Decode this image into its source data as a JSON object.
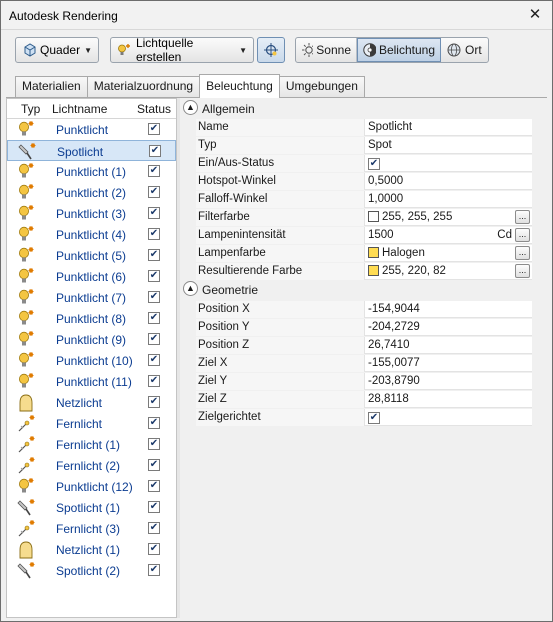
{
  "window": {
    "title": "Autodesk Rendering"
  },
  "toolbar": {
    "quader": "Quader",
    "create_light": "Lichtquelle erstellen",
    "sonne": "Sonne",
    "belichtung": "Belichtung",
    "ort": "Ort"
  },
  "tabs": [
    "Materialien",
    "Materialzuordnung",
    "Beleuchtung",
    "Umgebungen"
  ],
  "light_list": {
    "headers": {
      "type": "Typ",
      "name": "Lichtname",
      "status": "Status"
    },
    "items": [
      {
        "name": "Punktlicht",
        "icon": "point-light-icon"
      },
      {
        "name": "Spotlicht",
        "icon": "spot-light-icon"
      },
      {
        "name": "Punktlicht (1)",
        "icon": "point-light-icon"
      },
      {
        "name": "Punktlicht (2)",
        "icon": "point-light-icon"
      },
      {
        "name": "Punktlicht (3)",
        "icon": "point-light-icon"
      },
      {
        "name": "Punktlicht (4)",
        "icon": "point-light-icon"
      },
      {
        "name": "Punktlicht (5)",
        "icon": "point-light-icon"
      },
      {
        "name": "Punktlicht (6)",
        "icon": "point-light-icon"
      },
      {
        "name": "Punktlicht (7)",
        "icon": "point-light-icon"
      },
      {
        "name": "Punktlicht (8)",
        "icon": "point-light-icon"
      },
      {
        "name": "Punktlicht (9)",
        "icon": "point-light-icon"
      },
      {
        "name": "Punktlicht (10)",
        "icon": "point-light-icon"
      },
      {
        "name": "Punktlicht (11)",
        "icon": "point-light-icon"
      },
      {
        "name": "Netzlicht",
        "icon": "web-light-icon"
      },
      {
        "name": "Fernlicht",
        "icon": "distant-light-icon"
      },
      {
        "name": "Fernlicht (1)",
        "icon": "distant-light-icon"
      },
      {
        "name": "Fernlicht (2)",
        "icon": "distant-light-icon"
      },
      {
        "name": "Punktlicht (12)",
        "icon": "point-light-icon"
      },
      {
        "name": "Spotlicht (1)",
        "icon": "spot-light-icon"
      },
      {
        "name": "Fernlicht (3)",
        "icon": "distant-light-icon"
      },
      {
        "name": "Netzlicht (1)",
        "icon": "web-light-icon"
      },
      {
        "name": "Spotlicht (2)",
        "icon": "spot-light-icon"
      }
    ]
  },
  "properties": {
    "general_title": "Allgemein",
    "general": [
      {
        "label": "Name",
        "value": "Spotlicht"
      },
      {
        "label": "Typ",
        "value": "Spot"
      },
      {
        "label": "Ein/Aus-Status",
        "value": ""
      },
      {
        "label": "Hotspot-Winkel",
        "value": "0,5000"
      },
      {
        "label": "Falloff-Winkel",
        "value": "1,0000"
      },
      {
        "label": "Filterfarbe",
        "value": "255, 255, 255",
        "swatch": "#ffffff"
      },
      {
        "label": "Lampenintensität",
        "value": "1500",
        "unit": "Cd"
      },
      {
        "label": "Lampenfarbe",
        "value": "Halogen",
        "swatch": "#ffdc52"
      },
      {
        "label": "Resultierende Farbe",
        "value": "255, 220, 82",
        "swatch": "#ffdc52"
      }
    ],
    "geometry_title": "Geometrie",
    "geometry": [
      {
        "label": "Position X",
        "value": "-154,9044"
      },
      {
        "label": "Position Y",
        "value": "-204,2729"
      },
      {
        "label": "Position Z",
        "value": "26,7410"
      },
      {
        "label": "Ziel X",
        "value": "-155,0077"
      },
      {
        "label": "Ziel Y",
        "value": "-203,8790"
      },
      {
        "label": "Ziel Z",
        "value": "28,8118"
      },
      {
        "label": "Zielgerichtet",
        "value": ""
      }
    ]
  },
  "colors": {
    "accent": "#0b3c91",
    "selection": "#d7e7f7",
    "bulb": "#f4c542"
  }
}
